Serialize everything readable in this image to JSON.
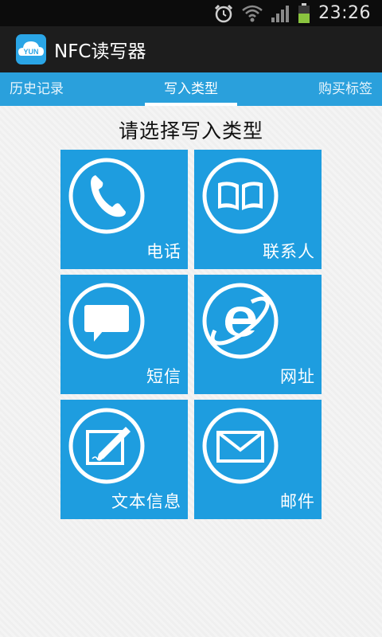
{
  "status_bar": {
    "time": "23:26",
    "icons": [
      "alarm-icon",
      "wifi-icon",
      "signal-icon",
      "battery-icon"
    ],
    "background": "#0c0c0c"
  },
  "action_bar": {
    "logo_text": "YUN",
    "title": "NFC读写器",
    "background": "#1d1d1d"
  },
  "tabs": [
    {
      "label": "历史记录",
      "selected": false
    },
    {
      "label": "写入类型",
      "selected": true
    },
    {
      "label": "购买标签",
      "selected": false
    }
  ],
  "main": {
    "heading": "请选择写入类型",
    "tiles": [
      {
        "label": "电话",
        "icon": "phone-icon"
      },
      {
        "label": "联系人",
        "icon": "book-icon"
      },
      {
        "label": "短信",
        "icon": "speech-bubble-icon"
      },
      {
        "label": "网址",
        "icon": "internet-explorer-icon"
      },
      {
        "label": "文本信息",
        "icon": "pen-note-icon"
      },
      {
        "label": "邮件",
        "icon": "envelope-icon"
      }
    ]
  },
  "colors": {
    "accent": "#2aa0dc",
    "tile": "#1e9ddf",
    "tile_text": "#ffffff"
  }
}
